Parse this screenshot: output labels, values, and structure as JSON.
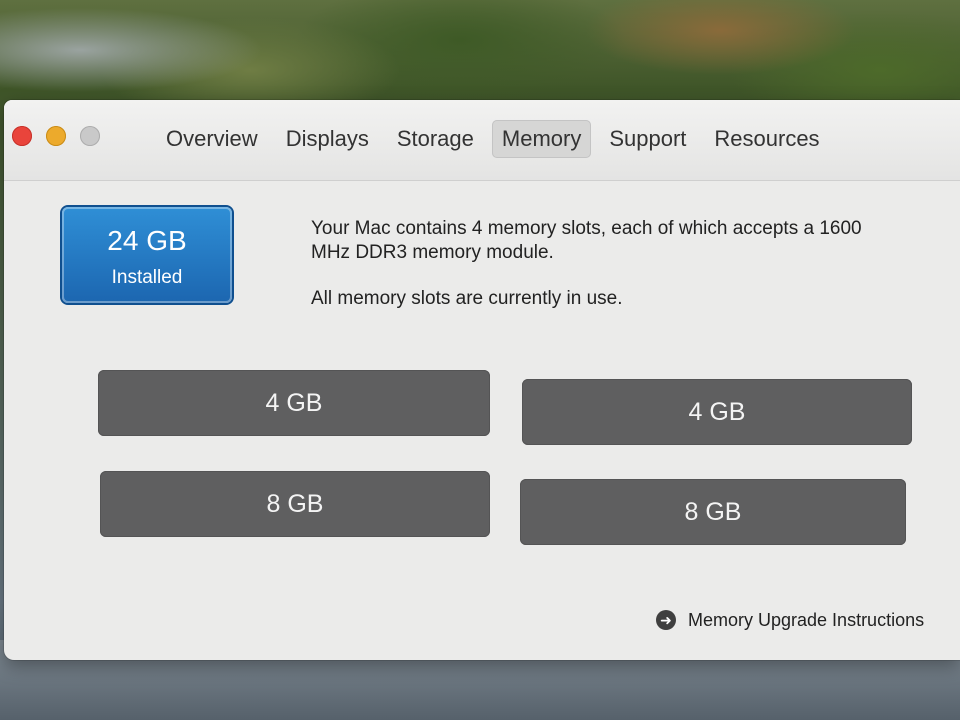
{
  "tabs": [
    {
      "label": "Overview"
    },
    {
      "label": "Displays"
    },
    {
      "label": "Storage"
    },
    {
      "label": "Memory",
      "active": true
    },
    {
      "label": "Support"
    },
    {
      "label": "Resources"
    }
  ],
  "memory": {
    "installed_size": "24 GB",
    "installed_label": "Installed",
    "description_line1": "Your Mac contains 4 memory slots, each of which accepts a 1600 MHz DDR3 memory module.",
    "description_line2": "All memory slots are currently in use.",
    "slots": [
      "4 GB",
      "4 GB",
      "8 GB",
      "8 GB"
    ],
    "upgrade_link": "Memory Upgrade Instructions"
  },
  "colors": {
    "installed_badge": "#1f72bf",
    "slot_fill": "#5f5f60",
    "close": "#e9443b",
    "minimize": "#ecaa2c",
    "zoom": "#c9c9c9"
  }
}
